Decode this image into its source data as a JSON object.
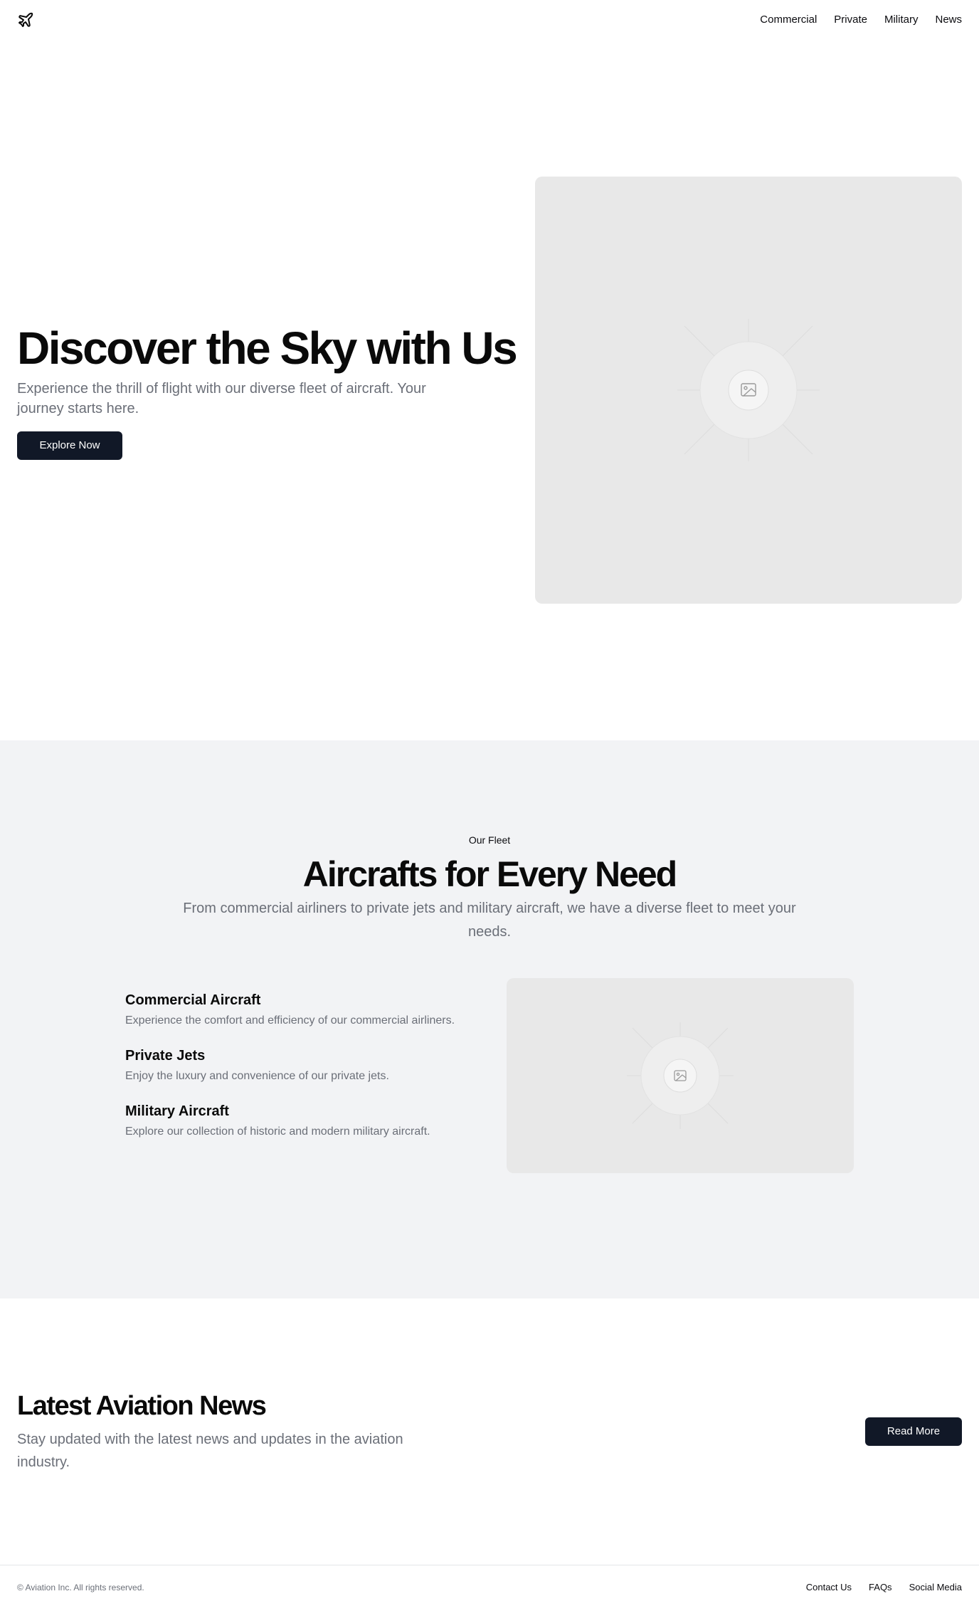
{
  "header": {
    "logo_icon": "airplane-icon",
    "nav": [
      "Commercial",
      "Private",
      "Military",
      "News"
    ]
  },
  "hero": {
    "title": "Discover the Sky with Us",
    "subtitle": "Experience the thrill of flight with our diverse fleet of aircraft. Your journey starts here.",
    "button": "Explore Now",
    "image_icon": "image-placeholder-icon"
  },
  "fleet": {
    "eyebrow": "Our Fleet",
    "title": "Aircrafts for Every Need",
    "subtitle": "From commercial airliners to private jets and military aircraft, we have a diverse fleet to meet your needs.",
    "features": [
      {
        "title": "Commercial Aircraft",
        "text": "Experience the comfort and efficiency of our commercial airliners."
      },
      {
        "title": "Private Jets",
        "text": "Enjoy the luxury and convenience of our private jets."
      },
      {
        "title": "Military Aircraft",
        "text": "Explore our collection of historic and modern military aircraft."
      }
    ],
    "image_icon": "image-placeholder-icon"
  },
  "news": {
    "title": "Latest Aviation News",
    "subtitle": "Stay updated with the latest news and updates in the aviation industry.",
    "button": "Read More"
  },
  "footer": {
    "copyright": "© Aviation Inc. All rights reserved.",
    "links": [
      "Contact Us",
      "FAQs",
      "Social Media"
    ]
  },
  "colors": {
    "primary_button": "#111827",
    "muted_text": "#6b6f78",
    "section_bg": "#f2f3f5",
    "placeholder_bg": "#e8e8e8"
  }
}
